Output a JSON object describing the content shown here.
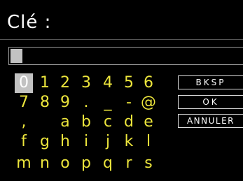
{
  "title": "Clé :",
  "input": {
    "value": ""
  },
  "keyboard": {
    "selected_key": "0",
    "rows": [
      [
        "0",
        "1",
        "2",
        "3",
        "4",
        "5",
        "6"
      ],
      [
        "7",
        "8",
        "9",
        ".",
        "_",
        "-",
        "@"
      ],
      [
        ",",
        " ",
        "a",
        "b",
        "c",
        "d",
        "e"
      ],
      [
        "f",
        "g",
        "h",
        "i",
        "j",
        "k",
        "l"
      ],
      [
        "m",
        "n",
        "o",
        "p",
        "q",
        "r",
        "s"
      ]
    ]
  },
  "buttons": {
    "backspace": "BKSP",
    "ok": "OK",
    "cancel": "ANNULER"
  },
  "colors": {
    "key_text": "#ece53c",
    "selection": "#c2c2c2",
    "background": "#000000"
  }
}
